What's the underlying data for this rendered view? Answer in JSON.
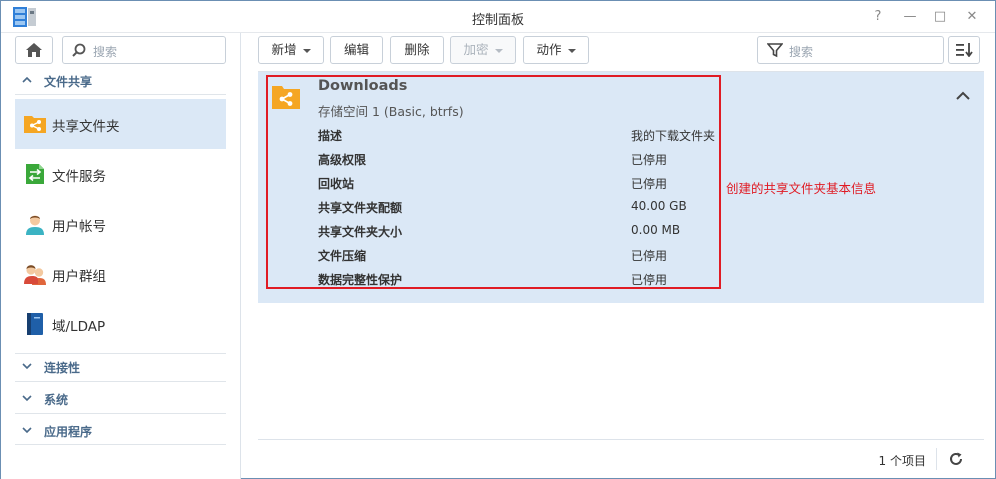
{
  "window": {
    "title": "控制面板",
    "controls": [
      "?",
      "—",
      "□",
      "✕"
    ]
  },
  "sidebar": {
    "search_placeholder": "搜索",
    "section_file_sharing": "文件共享",
    "items": [
      {
        "label": "共享文件夹",
        "icon": "shared-folder-icon",
        "active": true
      },
      {
        "label": "文件服务",
        "icon": "file-services-icon"
      },
      {
        "label": "用户帐号",
        "icon": "user-icon"
      },
      {
        "label": "用户群组",
        "icon": "group-icon"
      },
      {
        "label": "域/LDAP",
        "icon": "domain-ldap-icon"
      }
    ],
    "sections": [
      "连接性",
      "系统",
      "应用程序"
    ]
  },
  "toolbar": {
    "create": "新增",
    "edit": "编辑",
    "delete": "删除",
    "encrypt": "加密",
    "action": "动作",
    "filter_placeholder": "搜索"
  },
  "folder": {
    "name": "Downloads",
    "volume": "存储空间 1 (Basic, btrfs)",
    "properties": [
      {
        "label": "描述",
        "value": "我的下载文件夹"
      },
      {
        "label": "高级权限",
        "value": "已停用"
      },
      {
        "label": "回收站",
        "value": "已停用"
      },
      {
        "label": "共享文件夹配额",
        "value": "40.00 GB"
      },
      {
        "label": "共享文件夹大小",
        "value": "0.00 MB"
      },
      {
        "label": "文件压缩",
        "value": "已停用"
      },
      {
        "label": "数据完整性保护",
        "value": "已停用"
      }
    ]
  },
  "annotation": "创建的共享文件夹基本信息",
  "footer": {
    "item_count": "1 个项目"
  },
  "colors": {
    "accent": "#dbe8f6",
    "annotation_red": "#e01b24",
    "folder_orange": "#f5a623"
  }
}
